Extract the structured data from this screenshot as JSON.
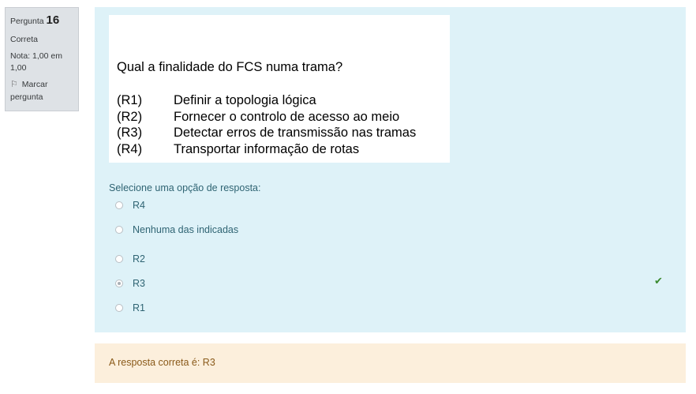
{
  "info": {
    "question_label": "Pergunta",
    "question_number": "16",
    "state": "Correta",
    "grade": "Nota: 1,00 em 1,00",
    "flag_label": "Marcar pergunta"
  },
  "question_image": {
    "title": "Qual a finalidade do FCS numa trama?",
    "options": [
      {
        "code": "(R1)",
        "text": "Definir a topologia lógica"
      },
      {
        "code": "(R2)",
        "text": "Fornecer o controlo de acesso ao meio"
      },
      {
        "code": "(R3)",
        "text": "Detectar erros de transmissão nas tramas"
      },
      {
        "code": "(R4)",
        "text": "Transportar informação de rotas"
      }
    ]
  },
  "prompt": "Selecione uma opção de resposta:",
  "answers": [
    {
      "label": "R4",
      "checked": false
    },
    {
      "label": "Nenhuma das indicadas",
      "checked": false
    },
    {
      "label": "R2",
      "checked": false
    },
    {
      "label": "R3",
      "checked": true
    },
    {
      "label": "R1",
      "checked": false
    }
  ],
  "feedback": {
    "right_answer": "A resposta correta é: R3"
  },
  "colors": {
    "content_bg": "#def2f8",
    "feedback_bg": "#fcefdc",
    "correct_check": "#3a8a2f"
  },
  "icons": {
    "flag": "flag-icon",
    "correct": "checkmark-icon"
  }
}
